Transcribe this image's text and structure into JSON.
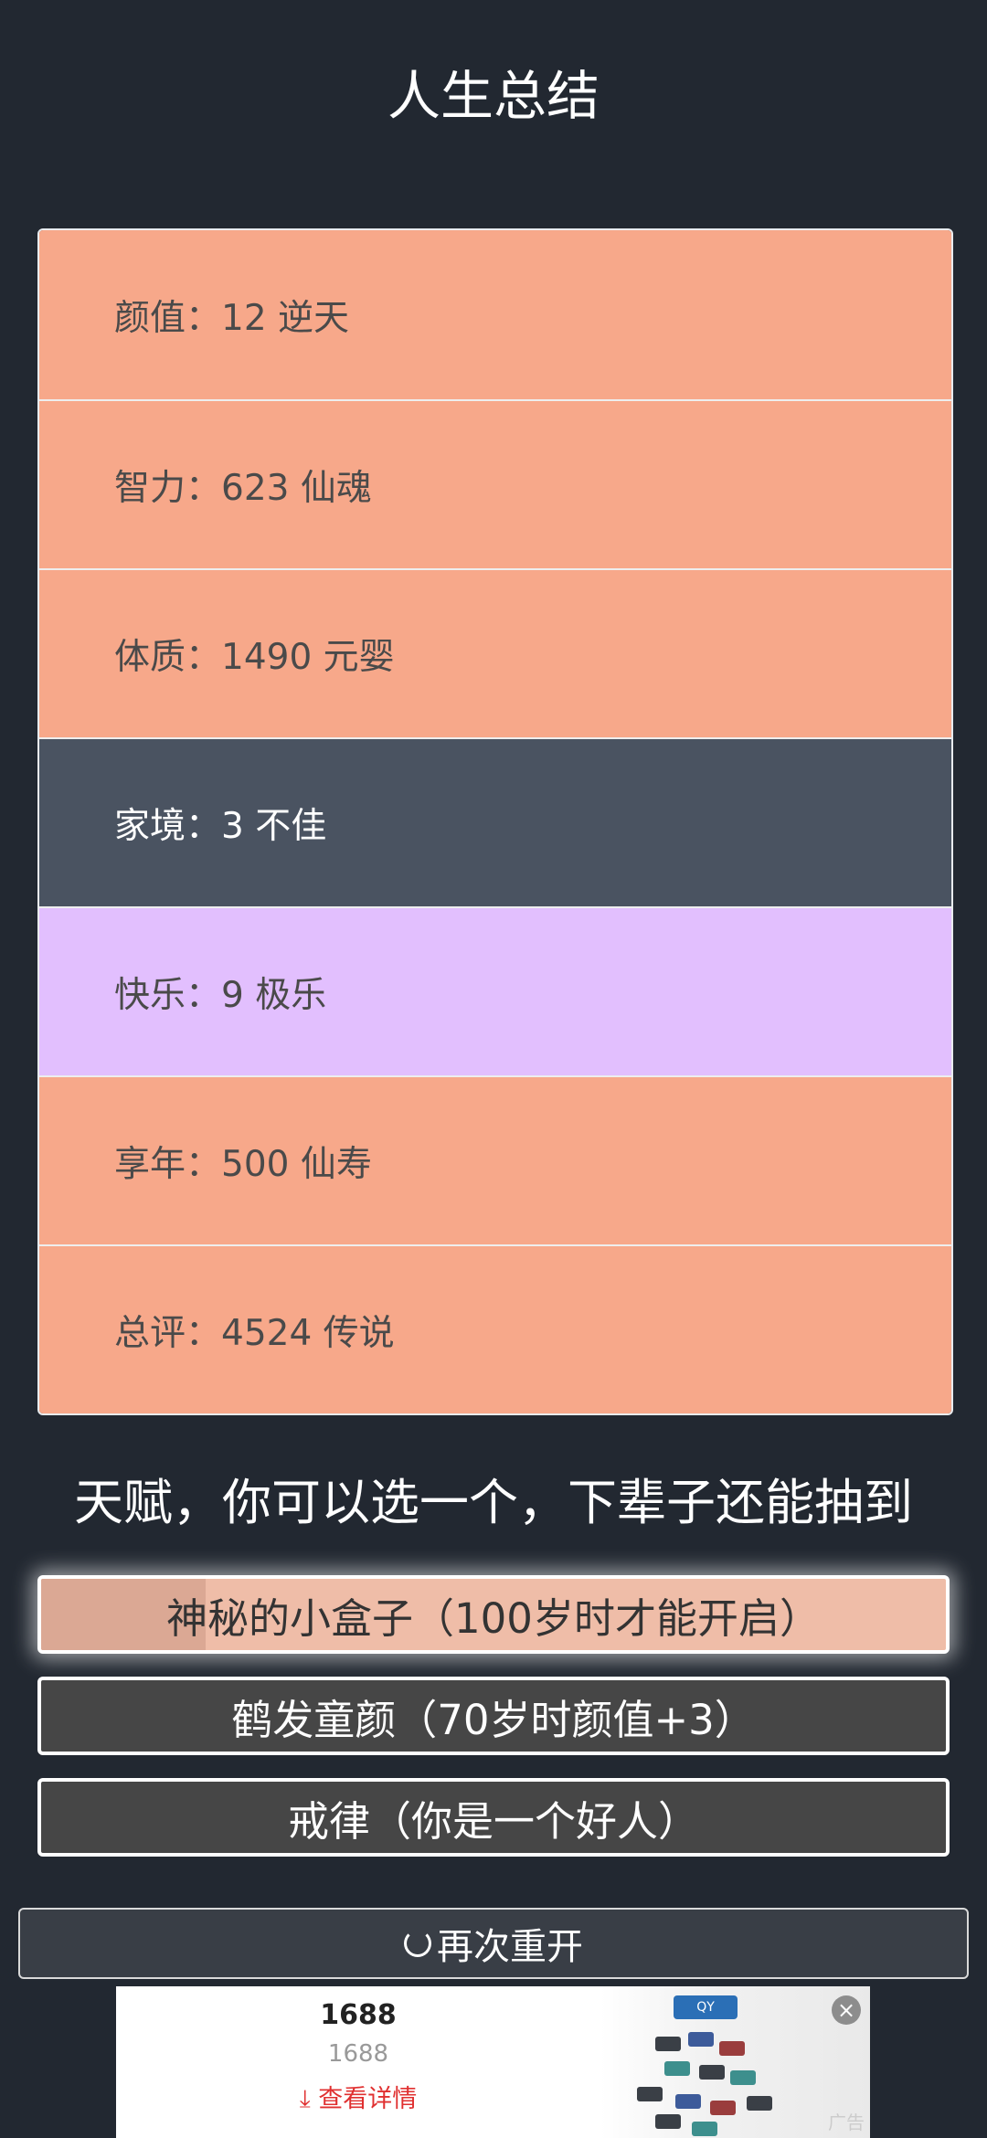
{
  "header": {
    "title": "人生总结"
  },
  "stats": [
    {
      "label": "颜值：",
      "value": "12 逆天",
      "color": "#f7a88a"
    },
    {
      "label": "智力：",
      "value": "623 仙魂",
      "color": "#f7a88a"
    },
    {
      "label": "体质：",
      "value": "1490 元婴",
      "color": "#f7a88a"
    },
    {
      "label": "家境：",
      "value": "3 不佳",
      "color": "#4a5361"
    },
    {
      "label": "快乐：",
      "value": "9 极乐",
      "color": "#e2bffe"
    },
    {
      "label": "享年：",
      "value": "500 仙寿",
      "color": "#f7a88a"
    },
    {
      "label": "总评：",
      "value": "4524 传说",
      "color": "#f7a88a"
    }
  ],
  "talents": {
    "title": "天赋，你可以选一个，下辈子还能抽到",
    "items": [
      {
        "label": "神秘的小盒子（100岁时才能开启）",
        "selected": true,
        "progress": 0.18
      },
      {
        "label": "鹤发童颜（70岁时颜值+3）",
        "selected": false
      },
      {
        "label": "戒律（你是一个好人）",
        "selected": false
      }
    ]
  },
  "restart": {
    "label": "再次重开",
    "icon": "refresh-icon"
  },
  "ad": {
    "title": "1688",
    "subtitle": "1688",
    "link": "查看详情",
    "link_icon": "download-arrow-icon",
    "logo": "QY",
    "tag": "广告",
    "close_icon": "close-icon"
  }
}
